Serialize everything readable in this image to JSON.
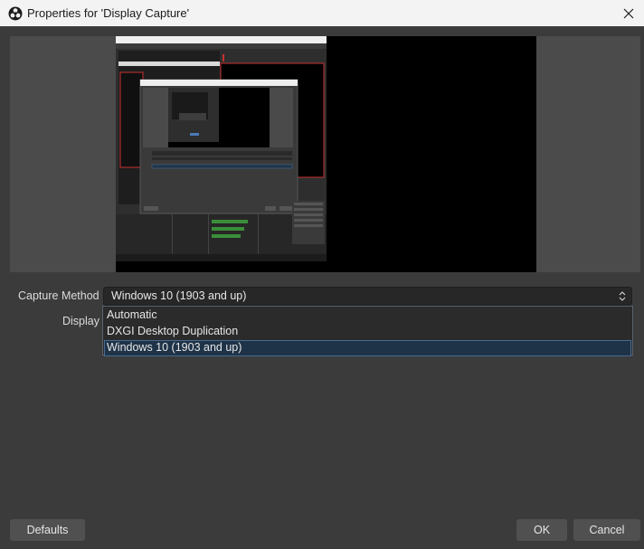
{
  "window": {
    "title": "Properties for 'Display Capture'",
    "app_icon": "obs-logo-icon",
    "close_icon": "close-icon"
  },
  "form": {
    "capture_method_label": "Capture Method",
    "capture_method_value": "Windows 10 (1903 and up)",
    "display_label": "Display",
    "dropdown_options": [
      "Automatic",
      "DXGI Desktop Duplication",
      "Windows 10 (1903 and up)"
    ],
    "selected_option": "Windows 10 (1903 and up)"
  },
  "buttons": {
    "defaults": "Defaults",
    "ok": "OK",
    "cancel": "Cancel"
  },
  "colors": {
    "background": "#3b3b3b",
    "preview_background": "#4b4b4b",
    "selection": "#1f3348",
    "capture_highlight": "#d22c2c"
  }
}
